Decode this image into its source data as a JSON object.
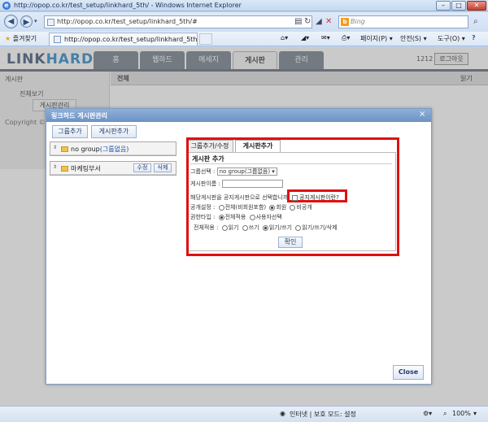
{
  "window": {
    "title": "http://opop.co.kr/test_setup/linkhard_5th/ - Windows Internet Explorer",
    "minimize": "–",
    "maximize": "□",
    "close": "✕"
  },
  "address_bar": {
    "url": "http://opop.co.kr/test_setup/linkhard_5th/#",
    "search_placeholder": "Bing"
  },
  "favorites_bar": {
    "favorites_label": "즐겨찾기",
    "tab_title": "http://opop.co.kr/test_setup/linkhard_5th/",
    "page_menu": "페이지(P) ▾",
    "safety_menu": "안전(S) ▾",
    "tools_menu": "도구(O) ▾",
    "help_icon": "?"
  },
  "app": {
    "logo_main": "LINK",
    "logo_accent": "HARD",
    "nav_tabs": [
      "홈",
      "웹하드",
      "메세지",
      "게시판",
      "관리"
    ],
    "active_tab": "게시판",
    "user_number": "1212",
    "logout_label": "로그아웃",
    "sidebar_heading": "게시판",
    "sidebar_item": "전체보기",
    "sub_tab": "게시판관리",
    "copyright": "Copyright © 20",
    "main_heading": "전체",
    "main_right": "읽기"
  },
  "modal": {
    "title": "링크하드 게시판관리",
    "close_label": "×",
    "add_group_button": "그룹추가",
    "add_board_button": "게시판추가",
    "tree": [
      {
        "label": "no group",
        "sub": "(그룹없음)"
      },
      {
        "label": "마케팅부서",
        "edit": "수정",
        "delete": "삭제"
      }
    ],
    "right_tabs": [
      "그룹추가/수정",
      "게시판추가"
    ],
    "active_right_tab": "게시판추가",
    "form": {
      "section_title": "게시판 추가",
      "group_label": "그룹선택 :",
      "group_value": "no group(그룹없음) ▾",
      "name_label": "게시판이름 :",
      "notice_question": "해당게시판을 공지게시판으로 선택합니까",
      "notice_checkbox": "공지게시판이란?",
      "public_label": "공개설정 :",
      "public_options": [
        "전체(비회원포함)",
        "회원",
        "비공개"
      ],
      "public_selected": 1,
      "permission_label": "권한타입 :",
      "permission_options": [
        "전체적용",
        "사용자선택"
      ],
      "permission_selected": 0,
      "apply_label": "전체적용 :",
      "apply_options": [
        "읽기",
        "쓰기",
        "읽기/쓰기",
        "읽기/쓰기/삭제"
      ],
      "apply_selected": 2,
      "confirm_button": "확인"
    },
    "close_button": "Close"
  },
  "status_bar": {
    "zone": "인터넷 | 보호 모드: 설정",
    "zoom": "100%"
  },
  "accent_colors": {
    "highlight": "#e01010",
    "modal_header": "#6c91c4"
  }
}
